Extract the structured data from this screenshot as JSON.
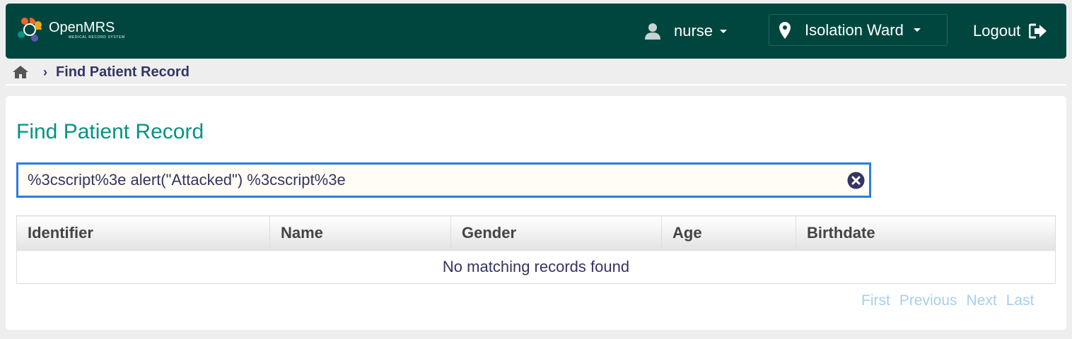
{
  "header": {
    "logo_name": "OpenMRS",
    "logo_sub": "MEDICAL RECORD SYSTEM",
    "user_label": "nurse",
    "location_label": "Isolation Ward",
    "logout_label": "Logout"
  },
  "breadcrumb": {
    "current": "Find Patient Record"
  },
  "main": {
    "title": "Find Patient Record",
    "search_value": "%3cscript%3e alert(\"Attacked\") %3cscript%3e",
    "table": {
      "columns": [
        "Identifier",
        "Name",
        "Gender",
        "Age",
        "Birthdate"
      ],
      "empty_message": "No matching records found"
    },
    "pager": {
      "first": "First",
      "previous": "Previous",
      "next": "Next",
      "last": "Last"
    }
  },
  "colors": {
    "header_bg": "#00463f",
    "title": "#009384",
    "search_border": "#2b7de0",
    "pager_disabled": "#a6cfea"
  }
}
